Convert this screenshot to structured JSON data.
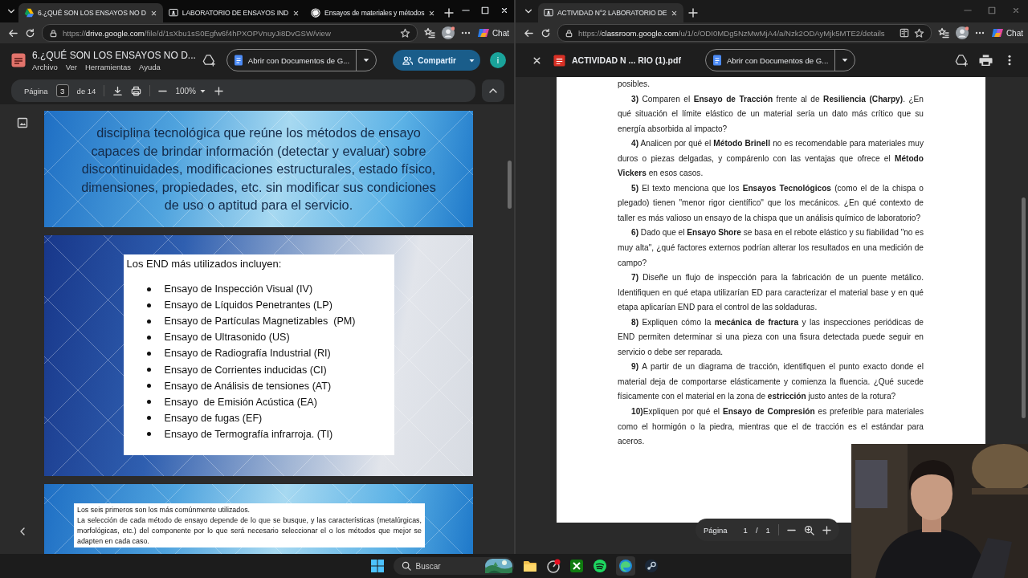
{
  "left_window": {
    "tabs": [
      {
        "title": "6.¿QUÉ SON LOS ENSAYOS NO D",
        "kind": "drive",
        "selected": true
      },
      {
        "title": "LABORATORIO DE ENSAYOS IND",
        "kind": "classroom",
        "selected": false
      },
      {
        "title": "Ensayos de materiales y métodos",
        "kind": "chatgpt",
        "selected": false
      }
    ],
    "url": {
      "scheme": "https://",
      "host": "drive.google.com",
      "path": "/file/d/1sXbu1sS0Egfw6f4hPXOPVnuyJi8DvGSW/view"
    },
    "chat_label": "Chat",
    "file_title": "6.¿QUÉ SON LOS ENSAYOS NO D...",
    "menu": [
      "Archivo",
      "Ver",
      "Herramientas",
      "Ayuda"
    ],
    "open_with": "Abrir con Documentos de G...",
    "share_label": "Compartir",
    "avatar_initial": "i",
    "page_toolbar": {
      "label": "Página",
      "value": "3",
      "of": "de 14",
      "zoom": "100%"
    },
    "slides": [
      {
        "kind": "paragraph",
        "text": "disciplina tecnológica que reúne los métodos de ensayo capaces de brindar información (detectar y evaluar) sobre discontinuidades, modificaciones estructurales, estado físico, dimensiones, propiedades, etc. sin modificar sus condiciones de uso o aptitud para el servicio."
      },
      {
        "kind": "list",
        "heading": "Los END más utilizados incluyen:",
        "items": [
          "Ensayo de Inspección Visual (IV)",
          "Ensayo de Líquidos Penetrantes (LP)",
          "Ensayo de Partículas Magnetizables  (PM)",
          "Ensayo de Ultrasonido (US)",
          "Ensayo de Radiografía Industrial (RI)",
          "Ensayo de Corrientes inducidas (CI)",
          "Ensayo de Análisis de tensiones (AT)",
          "Ensayo  de Emisión Acústica (EA)",
          "Ensayo de fugas (EF)",
          "Ensayo de Termografía infrarroja. (TI)"
        ]
      },
      {
        "kind": "note",
        "paragraphs": [
          "Los seis primeros son los más comúnmente utilizados.",
          "La selección de cada método de ensayo depende de lo que se busque, y las características (metalúrgicas, morfológicas, etc.) del componente por lo que será necesario seleccionar el o los métodos que mejor se adapten en cada caso."
        ]
      }
    ]
  },
  "right_window": {
    "tabs": [
      {
        "title": "ACTIVIDAD N°2 LABORATORIO DE",
        "kind": "classroom",
        "selected": true
      }
    ],
    "url": {
      "scheme": "https://",
      "host": "classroom.google.com",
      "path": "/u/1/c/ODI0MDg5NzMwMjA4/a/Nzk2ODAyMjk5MTE2/details"
    },
    "chat_label": "Chat",
    "file_title": "ACTIVIDAD N ... RIO (1).pdf",
    "open_with": "Abrir con Documentos de G...",
    "paragraphs": [
      {
        "continued": true,
        "text": "posibles."
      },
      {
        "continued": false,
        "text": "**3)** Comparen el **Ensayo de Tracción** frente al de **Resiliencia (Charpy)**. ¿En qué situación el límite elástico de un material sería un dato más crítico que su energía absorbida al impacto?"
      },
      {
        "continued": false,
        "text": "**4)** Analicen por qué el **Método Brinell** no es recomendable para materiales muy duros o piezas delgadas, y compárenlo con las ventajas que ofrece el **Método Vickers** en esos casos."
      },
      {
        "continued": false,
        "text": "**5)** El texto menciona que los **Ensayos Tecnológicos** (como el de la chispa o plegado) tienen \"menor rigor científico\" que los mecánicos. ¿En qué contexto de taller es más valioso un ensayo de la chispa que un análisis químico de laboratorio?"
      },
      {
        "continued": false,
        "text": "**6)** Dado que el **Ensayo Shore** se basa en el rebote elástico y su fiabilidad \"no es muy alta\", ¿qué factores externos podrían alterar los resultados en una medición de campo?"
      },
      {
        "continued": false,
        "text": "**7)** Diseñe un flujo de inspección para la fabricación de un puente metálico. Identifiquen en qué etapa utilizarían ED para caracterizar el material base y en qué etapa aplicarían END para el control de las soldaduras."
      },
      {
        "continued": false,
        "text": "**8)** Expliquen cómo la **mecánica de fractura** y las inspecciones periódicas de END permiten determinar si una pieza con una fisura detectada puede seguir en servicio o debe ser reparada."
      },
      {
        "continued": false,
        "text": "**9)** A partir de un diagrama de tracción, identifiquen el punto exacto donde el material deja de comportarse elásticamente y comienza la fluencia. ¿Qué sucede físicamente con el material en la zona de **estricción** justo antes de la rotura?"
      },
      {
        "continued": false,
        "text": "**10)**Expliquen por qué el **Ensayo de Compresión** es preferible para materiales como el hormigón o la piedra, mientras que el de tracción es el estándar para aceros."
      }
    ],
    "page_toolbar": {
      "label": "Página",
      "current": "1",
      "separator": "/",
      "total": "1"
    }
  },
  "taskbar": {
    "search_placeholder": "Buscar"
  }
}
